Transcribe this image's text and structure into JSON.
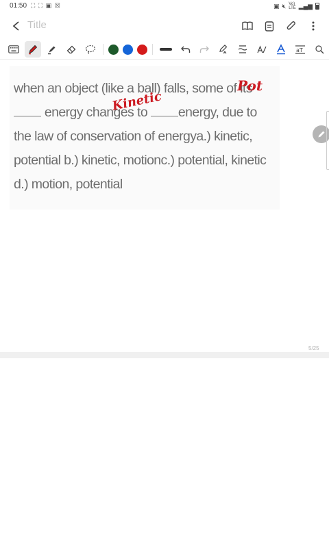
{
  "status_bar": {
    "time": "01:50",
    "left_icons": "⛶ ⛶ ▣ ☒",
    "right_icons": [
      "battery-saver-icon",
      "mute-icon",
      "volte-icon",
      "signal-icon",
      "battery-icon"
    ],
    "net_label": "Vo) LTE\nLTE1"
  },
  "app_bar": {
    "back_icon": "back-arrow-icon",
    "title_placeholder": "Title",
    "actions": [
      "book-view-icon",
      "page-view-icon",
      "attach-icon",
      "more-options-icon"
    ]
  },
  "toolbar": {
    "tools": [
      "keyboard-icon",
      "pen-icon",
      "highlighter-icon",
      "eraser-icon",
      "lasso-icon"
    ],
    "active_tool": "pen-icon",
    "colors": [
      "#1e5a2b",
      "#1565d8",
      "#d41b1b"
    ],
    "after_tools": [
      "undo-icon",
      "redo-icon",
      "pen-to-text-icon",
      "straighten-icon",
      "text-style-icon",
      "color-text-icon",
      "text-format-icon",
      "search-icon"
    ]
  },
  "note": {
    "question_before_pot": "when an object (like a ball) falls, some of its",
    "handwritten_pot": "Pot",
    "question_before_kinetic": "energy changes to",
    "handwritten_kinetic": "Kinetic",
    "question_after_kinetic": "energy, due to the law of conservation of energya.) kinetic, potential b.) kinetic, motionc.) potential, kinetic d.) motion, potential"
  },
  "page_counter": "5/25"
}
